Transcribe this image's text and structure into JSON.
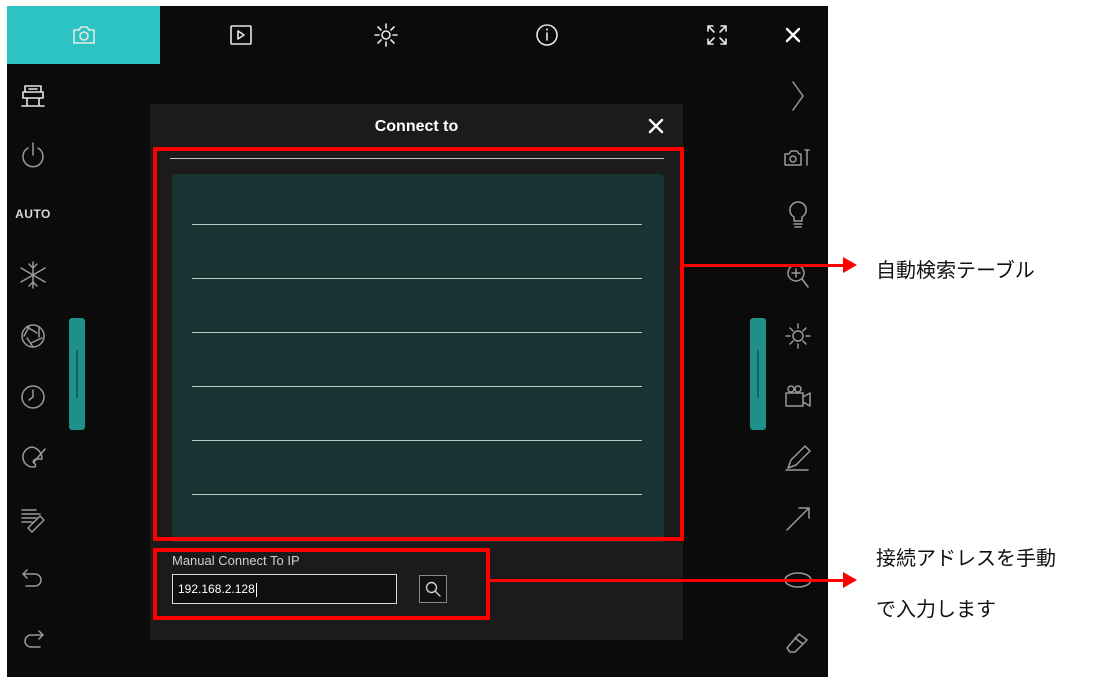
{
  "dialog": {
    "title": "Connect to",
    "table_rows": 6,
    "manual_label": "Manual Connect To IP",
    "ip_value": "192.168.2.128"
  },
  "left_toolbar": {
    "auto_label": "AUTO"
  },
  "annotations": {
    "table": "自動検索テーブル",
    "manual_line1": "接続アドレスを手動",
    "manual_line2": "で入力します"
  },
  "colors": {
    "accent": "#2ec3c3",
    "highlight": "#ff0000",
    "table_bg": "#193533"
  },
  "icons": {
    "top": [
      "camera-icon",
      "play-icon",
      "settings-icon",
      "info-icon",
      "fullscreen-icon",
      "close-icon"
    ],
    "left": [
      "document-camera-icon",
      "power-icon",
      "auto-focus-label",
      "freeze-icon",
      "aperture-icon",
      "timer-icon",
      "palette-icon",
      "eraser-pattern-icon",
      "undo-icon",
      "redo-icon"
    ],
    "right": [
      "collapse-chevron-icon",
      "camera-settings-icon",
      "lamp-icon",
      "zoom-in-icon",
      "brightness-icon",
      "record-icon",
      "pen-icon",
      "arrow-tool-icon",
      "ellipse-tool-icon",
      "eraser-icon"
    ]
  }
}
